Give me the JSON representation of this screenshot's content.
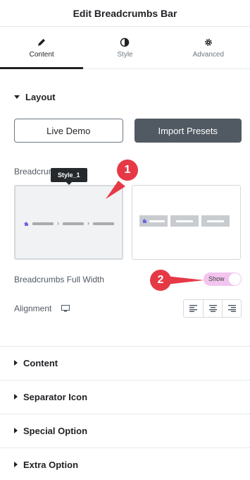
{
  "header": {
    "title": "Edit Breadcrumbs Bar"
  },
  "tabs": [
    {
      "label": "Content",
      "icon": "pencil-icon",
      "active": true
    },
    {
      "label": "Style",
      "icon": "contrast-icon",
      "active": false
    },
    {
      "label": "Advanced",
      "icon": "gear-icon",
      "active": false
    }
  ],
  "layout": {
    "title": "Layout",
    "live_demo_label": "Live Demo",
    "import_presets_label": "Import Presets",
    "style_label": "Breadcrumbs Style",
    "tooltip": "Style_1",
    "full_width_label": "Breadcrumbs Full Width",
    "full_width_toggle": "Show",
    "alignment_label": "Alignment",
    "alignment_options": [
      "left",
      "center",
      "right"
    ]
  },
  "annotations": {
    "marker1": "1",
    "marker2": "2"
  },
  "sections": [
    {
      "label": "Content"
    },
    {
      "label": "Separator Icon"
    },
    {
      "label": "Special Option"
    },
    {
      "label": "Extra Option"
    }
  ],
  "colors": {
    "accent_marker": "#e63946",
    "toggle_bg": "#f2c5ef",
    "dark_button": "#515962",
    "home_icon": "#6b65e6"
  }
}
